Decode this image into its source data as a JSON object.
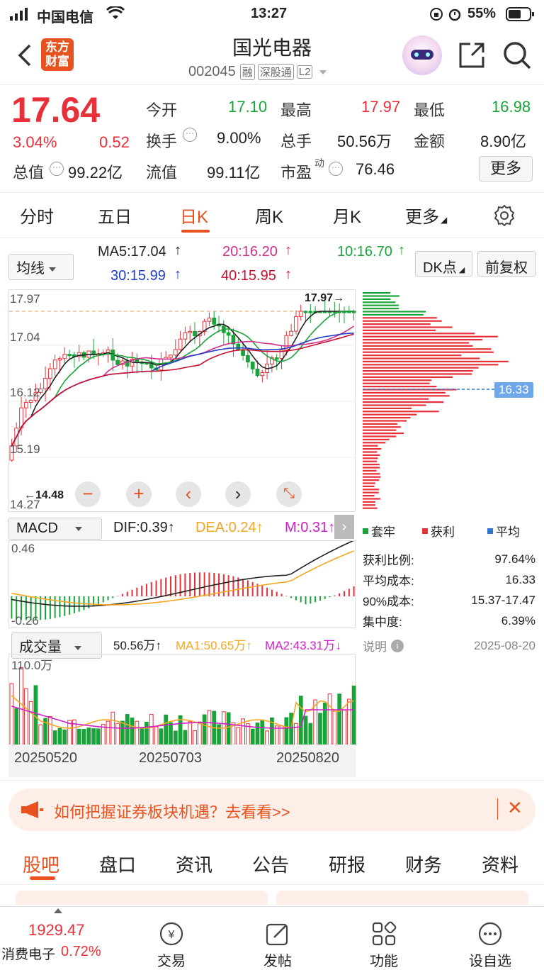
{
  "status": {
    "carrier": "中国电信",
    "time": "13:27",
    "battery": "55%"
  },
  "header": {
    "logo_line1": "东方",
    "logo_line2": "财富",
    "title": "国光电器",
    "code": "002045",
    "tags": [
      "融",
      "深股通",
      "L2"
    ]
  },
  "quote": {
    "price": "17.64",
    "change_pct": "3.04%",
    "change": "0.52",
    "cap_label": "总值",
    "cap_value": "99.22亿",
    "open_label": "今开",
    "open_value": "17.10",
    "turnover_label": "换手",
    "turnover_value": "9.00%",
    "float_label": "流值",
    "float_value": "99.11亿",
    "high_label": "最高",
    "high_value": "17.97",
    "vol_label": "总手",
    "vol_value": "50.56万",
    "pe_label": "市盈",
    "pe_sup": "动",
    "pe_value": "76.46",
    "low_label": "最低",
    "low_value": "16.98",
    "amount_label": "金额",
    "amount_value": "8.90亿",
    "more_label": "更多"
  },
  "ktabs": [
    "分时",
    "五日",
    "日K",
    "周K",
    "月K",
    "更多"
  ],
  "ma": {
    "selector": "均线",
    "ma5": "MA5:17.04",
    "ma20": "20:16.20",
    "ma10": "10:16.70",
    "ma30": "30:15.99",
    "ma40": "40:15.95",
    "dk": "DK点",
    "adjust": "前复权"
  },
  "price_axis": [
    "17.97",
    "17.04",
    "16.12",
    "15.19",
    "14.27"
  ],
  "chart_marks": {
    "high_mark": "17.97",
    "low_mark": "14.48",
    "avg_cost_tag": "16.33"
  },
  "macd": {
    "selector": "MACD",
    "dif": "DIF:0.39",
    "dea": "DEA:0.24",
    "m": "M:0.31",
    "top": "0.46",
    "bottom": "-0.26"
  },
  "volume": {
    "selector": "成交量",
    "vol": "50.56万",
    "ma1": "MA1:50.65万",
    "ma2": "MA2:43.31万",
    "top": "110.0万"
  },
  "dates": [
    "20250520",
    "20250703",
    "20250820"
  ],
  "chips": {
    "legend": [
      "套牢",
      "获利",
      "平均"
    ],
    "rows": [
      {
        "k": "获利比例:",
        "v": "97.64%"
      },
      {
        "k": "平均成本:",
        "v": "16.33"
      },
      {
        "k": "90%成本:",
        "v": "15.37-17.47"
      },
      {
        "k": "集中度:",
        "v": "6.39%"
      }
    ],
    "note_label": "说明",
    "note_date": "2025-08-20"
  },
  "banner": "如何把握证券板块机遇？去看看>>",
  "tabs2": [
    "股吧",
    "盘口",
    "资讯",
    "公告",
    "研报",
    "财务",
    "资料"
  ],
  "bottom": {
    "index_value": "1929.47",
    "index_name": "消费电子",
    "index_pct": "0.72%",
    "items": [
      "交易",
      "发帖",
      "功能",
      "设自选"
    ]
  },
  "colors": {
    "up": "#e8303a",
    "down": "#1aa33a",
    "accent": "#e8521f"
  }
}
